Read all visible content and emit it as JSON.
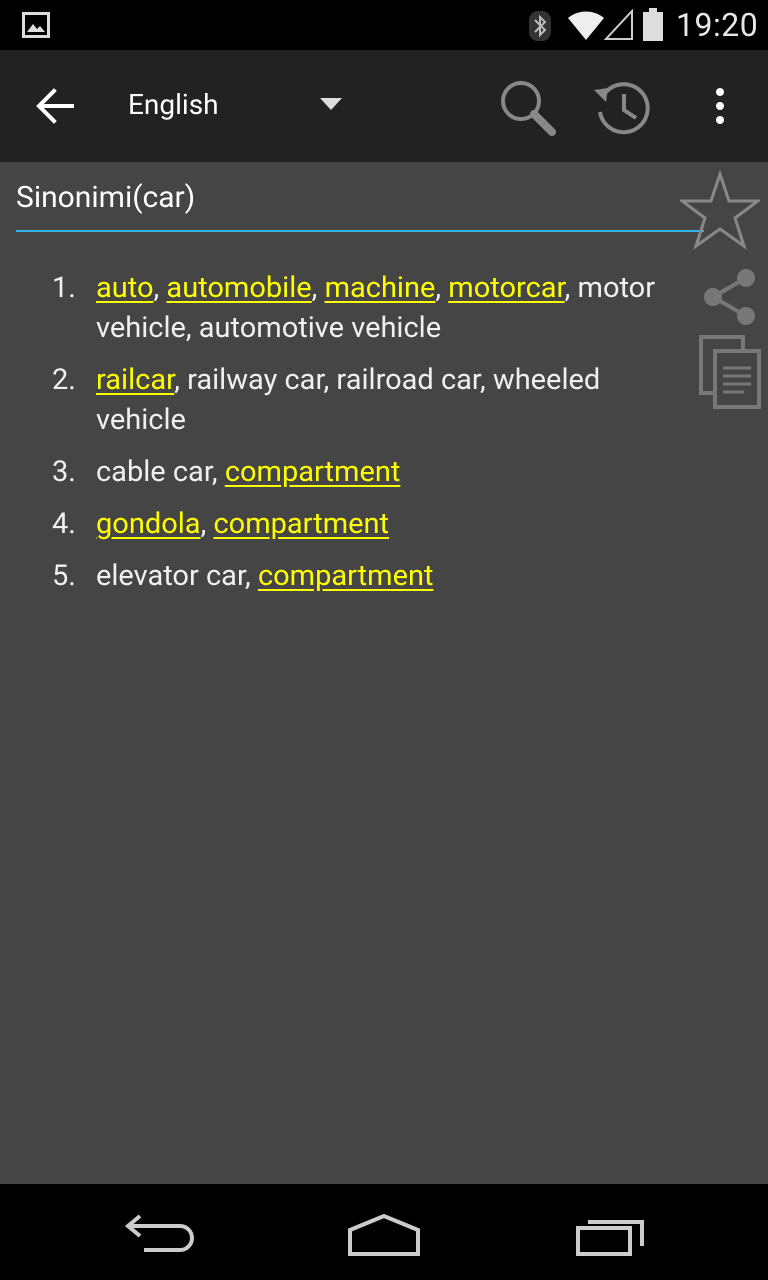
{
  "status_bar": {
    "time": "19:20"
  },
  "action_bar": {
    "language": "English"
  },
  "query": {
    "value": "Sinonimi(car)"
  },
  "synonyms": [
    {
      "number": "1.",
      "parts": [
        {
          "text": "auto",
          "link": true
        },
        {
          "text": ", ",
          "link": false
        },
        {
          "text": "automobile",
          "link": true
        },
        {
          "text": ", ",
          "link": false
        },
        {
          "text": "machine",
          "link": true
        },
        {
          "text": ", ",
          "link": false
        },
        {
          "text": "motorcar",
          "link": true
        },
        {
          "text": ", motor vehicle, automotive vehicle",
          "link": false
        }
      ]
    },
    {
      "number": "2.",
      "parts": [
        {
          "text": "railcar",
          "link": true
        },
        {
          "text": ", railway car, railroad car, wheeled vehicle",
          "link": false
        }
      ]
    },
    {
      "number": "3.",
      "parts": [
        {
          "text": "cable car, ",
          "link": false
        },
        {
          "text": "compartment",
          "link": true
        }
      ]
    },
    {
      "number": "4.",
      "parts": [
        {
          "text": "gondola",
          "link": true
        },
        {
          "text": ", ",
          "link": false
        },
        {
          "text": "compartment",
          "link": true
        }
      ]
    },
    {
      "number": "5.",
      "parts": [
        {
          "text": "elevator car, ",
          "link": false
        },
        {
          "text": "compartment",
          "link": true
        }
      ]
    }
  ],
  "colors": {
    "link": "#ffff00",
    "accent_underline": "#33b5e5",
    "background": "#454545",
    "action_bar": "#222222"
  },
  "icons": [
    "image-icon",
    "bluetooth-icon",
    "wifi-icon",
    "signal-icon",
    "battery-icon",
    "back-arrow-icon",
    "dropdown-arrow-icon",
    "search-icon",
    "history-icon",
    "overflow-menu-icon",
    "star-icon",
    "share-icon",
    "copy-icon",
    "nav-back-icon",
    "nav-home-icon",
    "nav-recents-icon"
  ]
}
